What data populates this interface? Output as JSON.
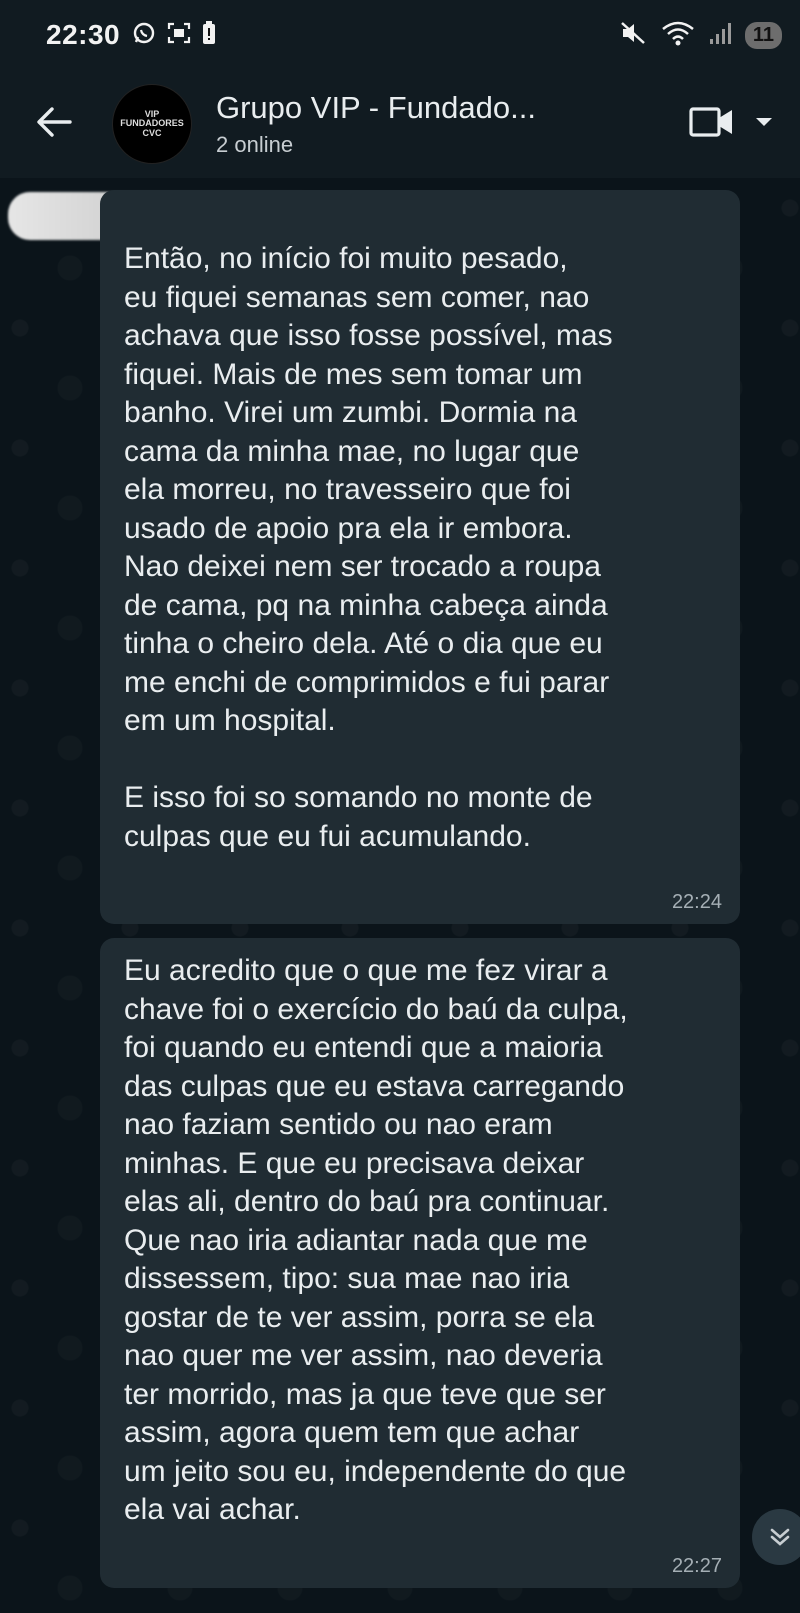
{
  "status_bar": {
    "time": "22:30",
    "battery": "11",
    "icons_left": [
      "whatsapp-icon",
      "screenshot-icon",
      "battery-saver-icon"
    ],
    "icons_right": [
      "mute-icon",
      "wifi-icon",
      "signal-icon"
    ]
  },
  "header": {
    "avatar_lines": [
      "VIP",
      "FUNDADORES",
      "CVC"
    ],
    "title": "Grupo VIP - Fundado...",
    "subtitle": "2 online",
    "icons": [
      "back-arrow-icon",
      "video-call-icon",
      "dropdown-icon"
    ]
  },
  "messages": [
    {
      "text": "Então, no início foi muito pesado,\neu fiquei semanas sem comer, nao\nachava que isso fosse possível, mas\nfiquei. Mais de mes sem tomar um\nbanho. Virei um zumbi. Dormia na\ncama da minha mae, no lugar que\nela morreu, no travesseiro que foi\nusado de apoio pra ela ir embora.\nNao deixei nem ser trocado a roupa\nde cama, pq na minha cabeça ainda\ntinha o cheiro dela. Até o dia que eu\nme enchi de comprimidos e fui parar\nem um hospital.\n\nE isso foi so somando no monte de\nculpas que eu fui acumulando.",
      "time": "22:24"
    },
    {
      "text": "Eu acredito que o que me fez virar a\nchave foi o exercício do baú da culpa,\nfoi quando eu entendi que a maioria\ndas culpas que eu estava carregando\nnao faziam sentido ou nao eram\nminhas. E que eu precisava deixar\nelas ali, dentro do baú pra continuar.\nQue nao iria adiantar nada que me\ndissessem, tipo: sua mae nao iria\ngostar de te ver assim, porra se ela\nnao quer me ver assim, nao deveria\nter morrido, mas ja que teve que ser\nassim, agora quem tem que achar\num jeito sou eu, independente do que\nela vai achar.",
      "time": "22:27"
    }
  ],
  "colors": {
    "background": "#0b141a",
    "bar": "#111b21",
    "bubble": "#202c33",
    "text": "#e9edef",
    "meta": "#a5afb5"
  }
}
